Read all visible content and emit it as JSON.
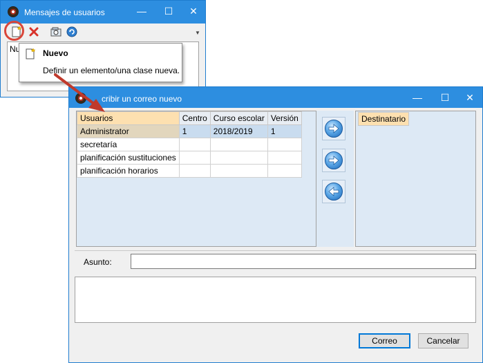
{
  "back_window": {
    "title": "Mensajes de usuarios",
    "list_header_partial": "Nu"
  },
  "tooltip": {
    "title": "Nuevo",
    "description": "Definir un elemento/una clase nueva."
  },
  "front_window": {
    "title": "Escribir un correo nuevo",
    "title_visible": "cribir un correo nuevo",
    "table": {
      "columns": [
        "Usuarios",
        "Centro",
        "Curso escolar",
        "Versión"
      ],
      "rows": [
        {
          "usuario": "Administrator",
          "centro": "1",
          "curso": "2018/2019",
          "version": "1"
        },
        {
          "usuario": "secretaría",
          "centro": "",
          "curso": "",
          "version": ""
        },
        {
          "usuario": "planificación sustituciones",
          "centro": "",
          "curso": "",
          "version": ""
        },
        {
          "usuario": "planificación horarios",
          "centro": "",
          "curso": "",
          "version": ""
        }
      ]
    },
    "recipients_header": "Destinatario",
    "subject_label": "Asunto:",
    "subject_value": "",
    "body_value": "",
    "ok_label": "Correo",
    "cancel_label": "Cancelar"
  },
  "colors": {
    "titlebar": "#2d8ee0",
    "header_cell": "#fde0b0",
    "selected_row": "#c9dcef",
    "highlight_circle": "#d9463a",
    "callout_arrow": "#c0392b"
  },
  "icons": {
    "new": "new-document-icon",
    "delete": "red-x-icon",
    "preview": "preview-icon",
    "refresh": "refresh-icon",
    "move_right": "arrow-right-icon",
    "move_left": "arrow-left-icon"
  }
}
